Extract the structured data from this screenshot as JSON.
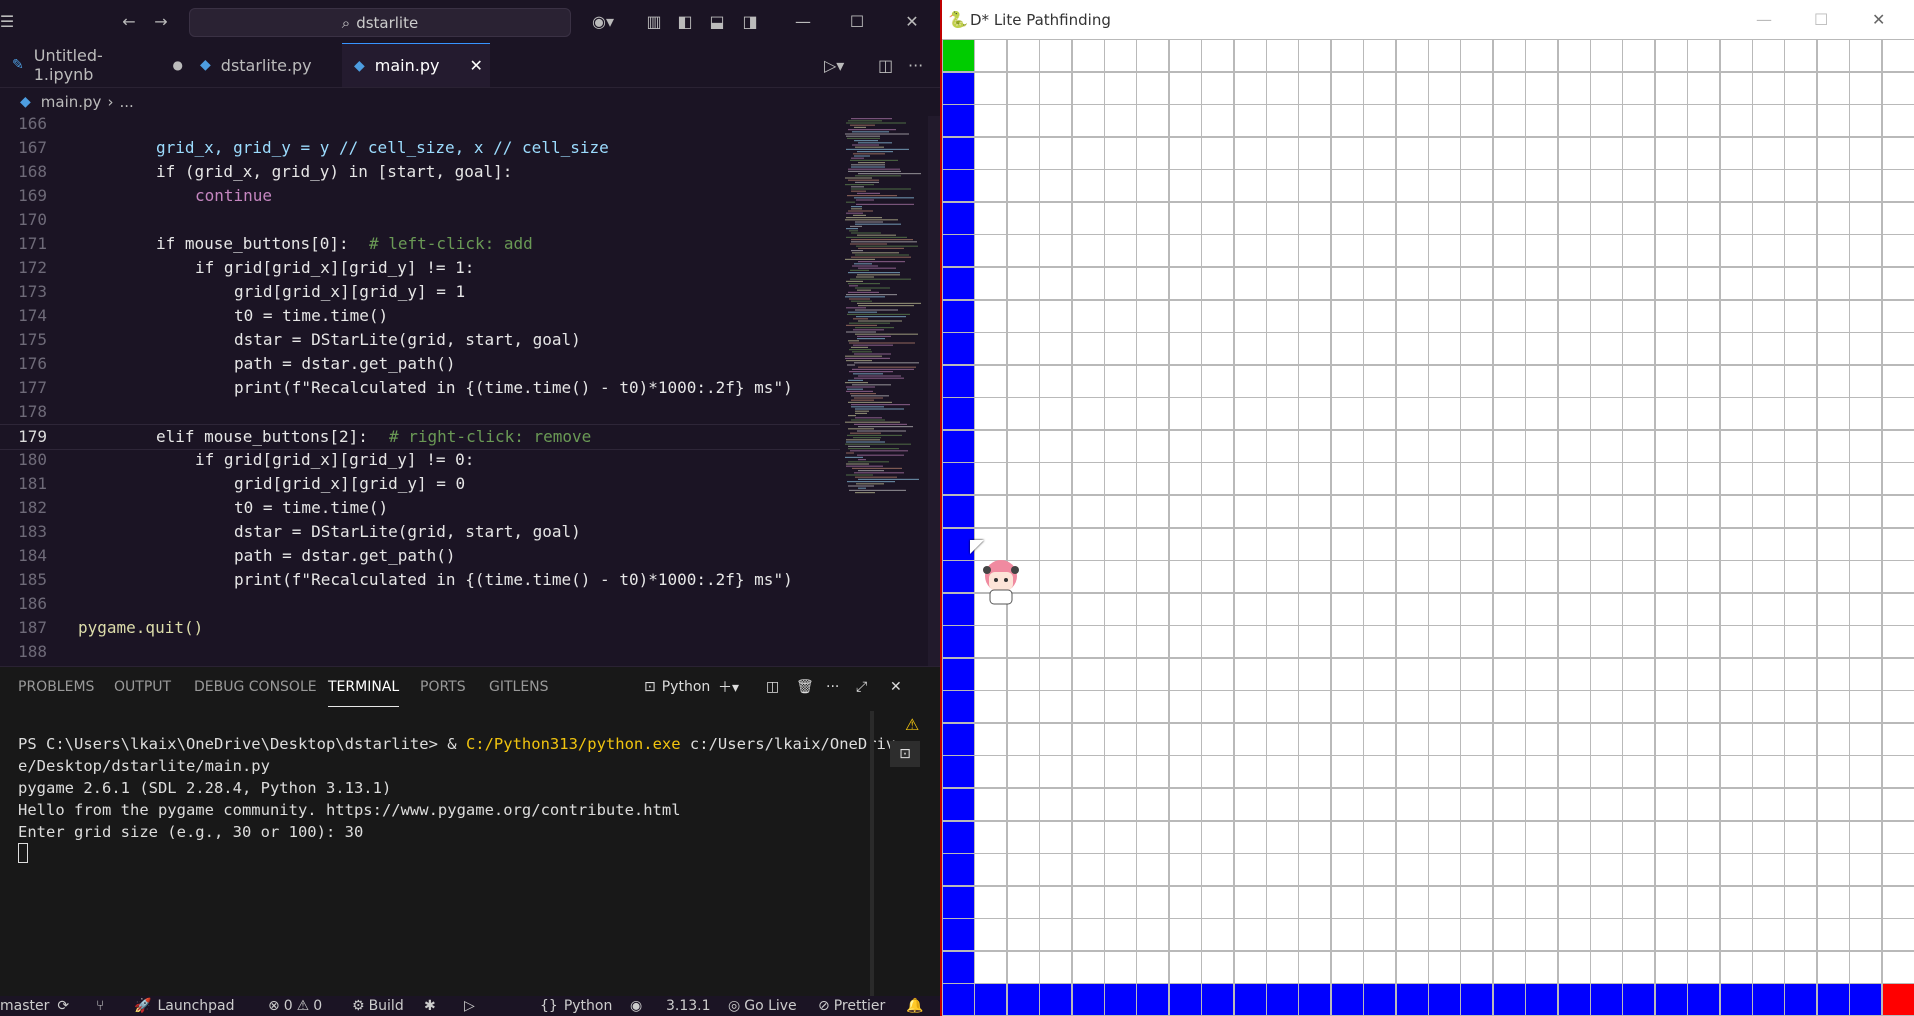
{
  "colors": {
    "accent": "#3794ff",
    "start": "#00cc00",
    "goal": "#ff0000",
    "wall": "#0000ff",
    "editor_bg": "#1b1424",
    "grid_line": "#b9b9b9"
  },
  "vscode": {
    "search_text": "dstarlite",
    "tabs": [
      {
        "label": "Untitled-1.ipynb",
        "modified": true
      },
      {
        "label": "dstarlite.py"
      },
      {
        "label": "main.py",
        "active": true
      }
    ],
    "breadcrumb": {
      "file": "main.py",
      "rest": "..."
    },
    "line_numbers": [
      "166",
      "167",
      "168",
      "169",
      "170",
      "171",
      "172",
      "173",
      "174",
      "175",
      "176",
      "177",
      "178",
      "179",
      "180",
      "181",
      "182",
      "183",
      "184",
      "185",
      "186",
      "187",
      "188"
    ],
    "code": {
      "l167": "grid_x, grid_y = y // cell_size, x // cell_size",
      "l168": "if (grid_x, grid_y) in [start, goal]:",
      "l169": "continue",
      "l171_code": "if mouse_buttons[0]:",
      "l171_comment": "# left-click: add",
      "l172": "if grid[grid_x][grid_y] != 1:",
      "l173": "grid[grid_x][grid_y] = 1",
      "l174": "t0 = time.time()",
      "l175": "dstar = DStarLite(grid, start, goal)",
      "l176": "path = dstar.get_path()",
      "l177": "print(f\"Recalculated in {(time.time() - t0)*1000:.2f} ms\")",
      "l179_code": "elif mouse_buttons[2]:",
      "l179_comment": "# right-click: remove",
      "l180": "if grid[grid_x][grid_y] != 0:",
      "l181": "grid[grid_x][grid_y] = 0",
      "l182": "t0 = time.time()",
      "l183": "dstar = DStarLite(grid, start, goal)",
      "l184": "path = dstar.get_path()",
      "l185": "print(f\"Recalculated in {(time.time() - t0)*1000:.2f} ms\")",
      "l187": "pygame.quit()"
    },
    "panel_tabs": [
      "PROBLEMS",
      "OUTPUT",
      "DEBUG CONSOLE",
      "TERMINAL",
      "PORTS",
      "GITLENS"
    ],
    "terminal_profile": "Python",
    "terminal": {
      "prompt": "PS C:\\Users\\lkaix\\OneDrive\\Desktop\\dstarlite> & ",
      "exe": "C:/Python313/python.exe",
      "arg1": " c:/Users/lkaix/OneDriv",
      "arg2": "e/Desktop/dstarlite/main.py",
      "out1": "pygame 2.6.1 (SDL 2.28.4, Python 3.13.1)",
      "out2": "Hello from the pygame community. https://www.pygame.org/contribute.html",
      "out3": "Enter grid size (e.g., 30 or 100): 30"
    },
    "status": {
      "branch": "master",
      "launchpad": "Launchpad",
      "errors": "0",
      "warnings": "0",
      "build": "Build",
      "language": "Python",
      "python_version": "3.13.1",
      "golive": "Go Live",
      "prettier": "Prettier"
    }
  },
  "game": {
    "title": "D* Lite Pathfinding",
    "grid_size": 30,
    "start_cell": [
      0,
      0
    ],
    "goal_cell": [
      29,
      29
    ],
    "wall_column": 0,
    "wall_row": 29,
    "sprite_cell": [
      16,
      1
    ]
  }
}
